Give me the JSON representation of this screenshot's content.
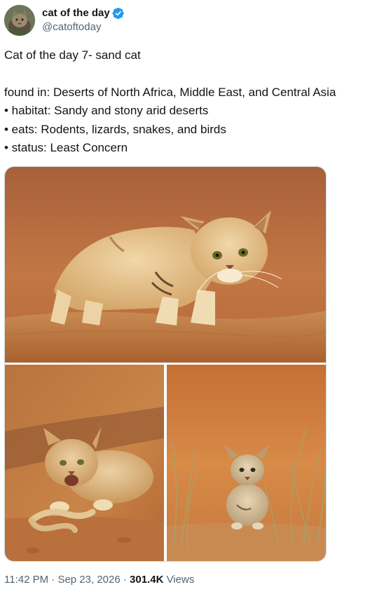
{
  "author": {
    "display_name": "cat of the day",
    "handle": "@catoftoday",
    "avatar_icon": "cat-avatar-icon",
    "verified_icon": "verified-badge-icon",
    "verified_color": "#1d9bf0"
  },
  "tweet": {
    "title_line": "Cat of the day 7- sand cat",
    "lines": [
      "found in: Deserts of North Africa, Middle East, and Central Asia",
      "• habitat: Sandy and stony arid deserts",
      "• eats: Rodents, lizards, snakes, and birds",
      "• status: Least Concern"
    ]
  },
  "media": {
    "photos": [
      {
        "subject": "sand cat stalking across sand dune"
      },
      {
        "subject": "sand cat crouching with snake"
      },
      {
        "subject": "sand cat kitten in desert grass"
      }
    ]
  },
  "meta": {
    "time": "11:42 PM",
    "separator": " · ",
    "date": "Sep 23, 2026",
    "views_count": "301.4K",
    "views_label": " Views"
  }
}
